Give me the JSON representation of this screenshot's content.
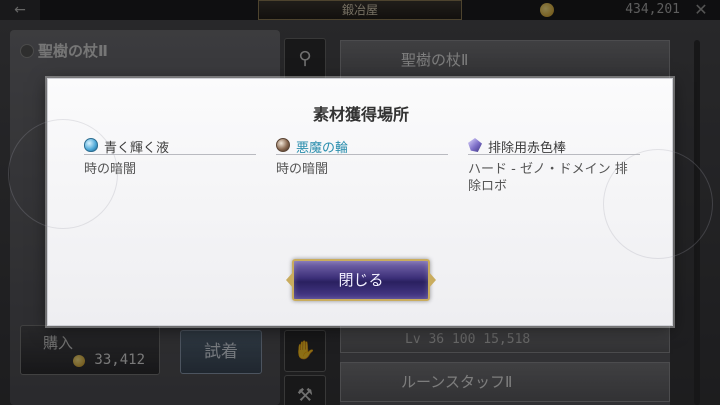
{
  "header": {
    "back_icon": "←",
    "shop_title": "鍛冶屋",
    "coin_value": "434,201",
    "close_icon": "✕"
  },
  "left_panel": {
    "item_name": "聖樹の杖Ⅱ",
    "buy_label": "購入",
    "buy_cost": "33,412",
    "try_label": "試着"
  },
  "right_panel": {
    "items": [
      {
        "name": "聖樹の杖Ⅱ"
      },
      {
        "stats": "Lv    36       100        15,518"
      },
      {
        "name": "ルーンスタッフⅡ"
      }
    ]
  },
  "dialog": {
    "title": "素材獲得場所",
    "materials": [
      {
        "name": "青く輝く液",
        "icon": "liquid-icon",
        "location": "時の暗闇",
        "highlight": false
      },
      {
        "name": "悪魔の輪",
        "icon": "ring-icon",
        "location": "時の暗闇",
        "highlight": true
      },
      {
        "name": "排除用赤色棒",
        "icon": "rod-icon",
        "location": "ハード - ゼノ・ドメイン 排除ロボ",
        "highlight": false
      }
    ],
    "close_label": "閉じる"
  },
  "colors": {
    "highlight_text": "#2c8fae",
    "button_gold_border": "#c9ac5e",
    "button_purple": "#3c2f78"
  }
}
